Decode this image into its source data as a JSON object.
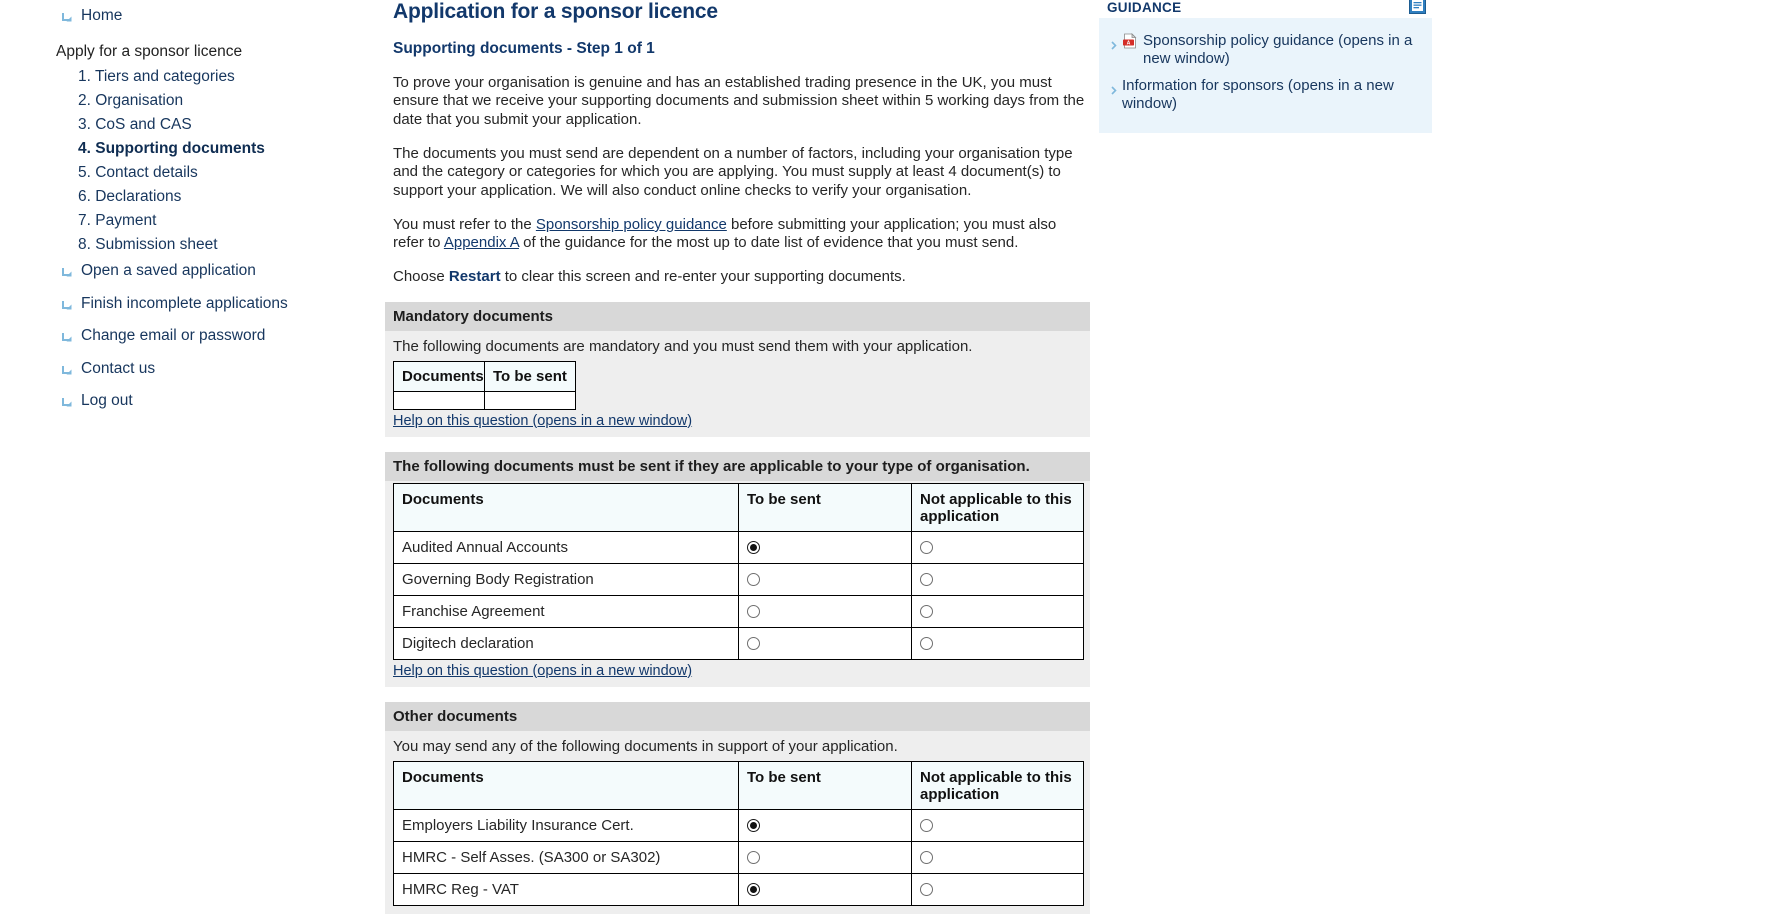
{
  "sidebar": {
    "home": {
      "label": "Home",
      "icon": "arrow-down-right-icon"
    },
    "group_title": "Apply for a sponsor licence",
    "steps": [
      {
        "label": "1. Tiers and categories",
        "current": false
      },
      {
        "label": "2. Organisation",
        "current": false
      },
      {
        "label": "3. CoS and CAS",
        "current": false
      },
      {
        "label": "4. Supporting documents",
        "current": true
      },
      {
        "label": "5. Contact details",
        "current": false
      },
      {
        "label": "6. Declarations",
        "current": false
      },
      {
        "label": "7. Payment",
        "current": false
      },
      {
        "label": "8. Submission sheet",
        "current": false
      }
    ],
    "links": [
      {
        "label": "Open a saved application",
        "icon": "arrow-down-right-icon"
      },
      {
        "label": "Finish incomplete applications",
        "icon": "arrow-down-right-icon"
      },
      {
        "label": "Change email or password",
        "icon": "arrow-down-right-icon"
      },
      {
        "label": "Contact us",
        "icon": "arrow-down-right-icon"
      },
      {
        "label": "Log out",
        "icon": "arrow-down-right-icon"
      }
    ]
  },
  "main": {
    "page_title": "Application for a sponsor licence",
    "step_title": "Supporting documents - Step 1 of 1",
    "para1": "To prove your organisation is genuine and has an established trading presence in the UK, you must ensure that we receive your supporting documents and submission sheet within 5 working days from the date that you submit your application.",
    "para2": "The documents you must send are dependent on a number of factors, including your organisation type and the category or categories for which you are applying. You must supply at least 4 document(s) to support your application. We will also conduct online checks to verify your organisation.",
    "para3_pre": "You must refer to the ",
    "para3_link1": "Sponsorship policy guidance",
    "para3_mid": " before submitting your application; you must also refer to ",
    "para3_link2": "Appendix A",
    "para3_post": " of the guidance for the most up to date list of evidence that you must send.",
    "para4_pre": "Choose ",
    "para4_bold": "Restart",
    "para4_post": " to clear this screen and re-enter your supporting documents.",
    "help_link": "Help on this question (opens in a new window)"
  },
  "mandatory_section": {
    "header": "Mandatory documents",
    "intro": "The following documents are mandatory and you must send them with your application.",
    "columns": [
      "Documents",
      "To be sent"
    ],
    "rows": [
      {
        "document": "",
        "to_be_sent": false
      }
    ]
  },
  "applicable_section": {
    "header": "The following documents must be sent if they are applicable to your type of organisation.",
    "columns": [
      "Documents",
      "To be sent",
      "Not applicable to this application"
    ],
    "rows": [
      {
        "document": "Audited Annual Accounts",
        "to_be_sent": true,
        "not_applicable": false
      },
      {
        "document": "Governing Body Registration",
        "to_be_sent": false,
        "not_applicable": false
      },
      {
        "document": "Franchise Agreement",
        "to_be_sent": false,
        "not_applicable": false
      },
      {
        "document": "Digitech declaration",
        "to_be_sent": false,
        "not_applicable": false
      }
    ]
  },
  "other_section": {
    "header": "Other documents",
    "intro": "You may send any of the following documents in support of your application.",
    "columns": [
      "Documents",
      "To be sent",
      "Not applicable to this application"
    ],
    "rows": [
      {
        "document": "Employers Liability Insurance Cert.",
        "to_be_sent": true,
        "not_applicable": false
      },
      {
        "document": "HMRC - Self Asses. (SA300 or SA302)",
        "to_be_sent": false,
        "not_applicable": false
      },
      {
        "document": "HMRC Reg - VAT",
        "to_be_sent": true,
        "not_applicable": false
      }
    ]
  },
  "guidance": {
    "title": "GUIDANCE",
    "panel_icon": "document-window-icon",
    "items": [
      {
        "label": "Sponsorship policy guidance (opens in a new window)",
        "icon": "pdf-icon"
      },
      {
        "label": "Information for sponsors (opens in a new window)",
        "icon": "chevron-right-icon"
      }
    ]
  },
  "colors": {
    "heading_navy": "#12386b",
    "link_navy": "#17365d",
    "section_header_gray": "#d8d8d8",
    "section_body_gray": "#eeeeee",
    "table_header_blue": "#f4fbfc",
    "guidance_blue": "#eaf4fb"
  }
}
